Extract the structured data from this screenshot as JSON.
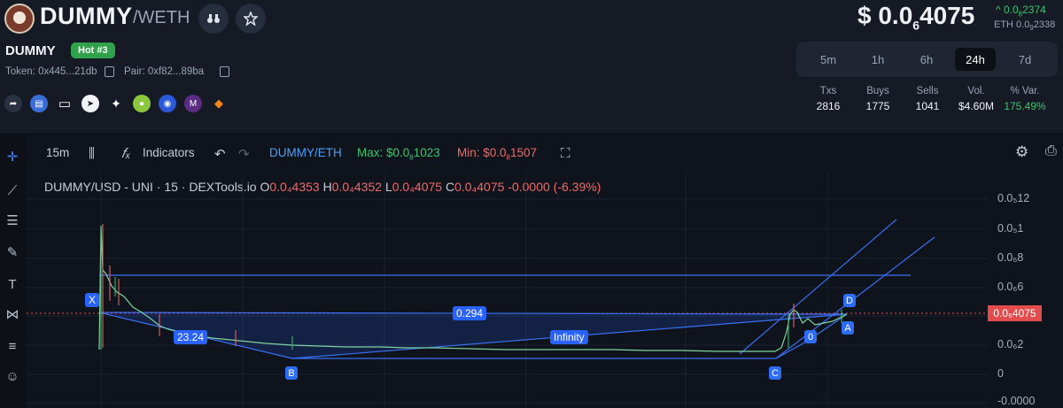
{
  "header": {
    "base": "DUMMY",
    "quote": "/WETH",
    "name": "DUMMY",
    "hot_badge": "Hot #3",
    "token_label": "Token: 0x445...21db",
    "pair_label": "Pair: 0xf82...89ba",
    "icons": [
      "binoculars-icon",
      "star-icon"
    ],
    "socials": [
      "share-icon",
      "chart-icon",
      "monitor-icon",
      "telegram-icon",
      "twitter-icon",
      "coingecko-icon",
      "coinmarketcap-icon",
      "website-icon",
      "metamask-icon"
    ]
  },
  "price": {
    "prefix": "$ 0.0",
    "sub": "6",
    "tail": "4075",
    "change_arrow": "^",
    "change_prefix": "0.0",
    "change_sub": "8",
    "change_tail": "2374",
    "eth_prefix": "ETH 0.0",
    "eth_sub": "9",
    "eth_tail": "2338"
  },
  "timeframes": [
    "5m",
    "1h",
    "6h",
    "24h",
    "7d"
  ],
  "active_timeframe": "24h",
  "stats": [
    {
      "label": "Txs",
      "value": "2816"
    },
    {
      "label": "Buys",
      "value": "1775"
    },
    {
      "label": "Sells",
      "value": "1041"
    },
    {
      "label": "Vol.",
      "value": "$4.60M"
    },
    {
      "label": "% Var.",
      "value": "175.49%"
    }
  ],
  "toolbar": {
    "interval": "15m",
    "indicators": "Indicators",
    "symbol": "DUMMY/ETH",
    "max_label": "Max: $0.0",
    "max_sub": "8",
    "max_tail": "1023",
    "min_label": "Min: $0.0",
    "min_sub": "8",
    "min_tail": "1507"
  },
  "legend": {
    "title": "DUMMY/USD - UNI · 15 · DEXTools.io",
    "o_label": "O",
    "o_val": "0.0₄4353",
    "h_label": "H",
    "h_val": "0.0₄4352",
    "l_label": "L",
    "l_val": "0.0₄4075",
    "c_label": "C",
    "c_val": "0.0₄4075",
    "change": "-0.0000 (-6.39%)"
  },
  "axis": {
    "ticks": [
      "0.0₅12",
      "0.0₅1",
      "0.0₆8",
      "0.0₆6",
      "0.0₆2",
      "0",
      "-0.0000"
    ],
    "current_price": "0.0₆4075"
  },
  "pattern": {
    "points": [
      "X",
      "B",
      "C",
      "0",
      "A",
      "D"
    ],
    "ratios": [
      "23.24",
      "0.294",
      "Infinity"
    ]
  },
  "colors": {
    "up": "#3ec46d",
    "down": "#f06a6a",
    "accent": "#2962ff",
    "price_line": "#e24c4c"
  }
}
